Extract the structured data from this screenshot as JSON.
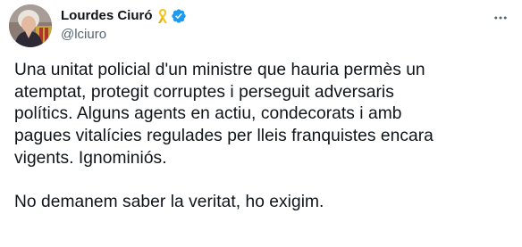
{
  "author": {
    "display_name": "Lourdes Ciuró",
    "handle": "@lciuro",
    "badges": [
      "yellow-ribbon-icon",
      "verified-badge-icon"
    ],
    "avatar": "avatar-photo"
  },
  "menu": {
    "icon": "more-options-icon"
  },
  "tweet": {
    "text": "Una unitat policial d'un ministre que hauria permès un\natemptat, protegit corruptes i perseguit adversaris\npolítics. Alguns agents en actiu, condecorats i amb\npagues vitalícies regulades per lleis franquistes encara\nvigents. Ignominiós.\n\nNo demanem saber la veritat, ho exigim."
  },
  "colors": {
    "text": "#0f1419",
    "secondary_text": "#536471",
    "verified": "#1d9bf0",
    "ribbon": "#f5c518"
  }
}
